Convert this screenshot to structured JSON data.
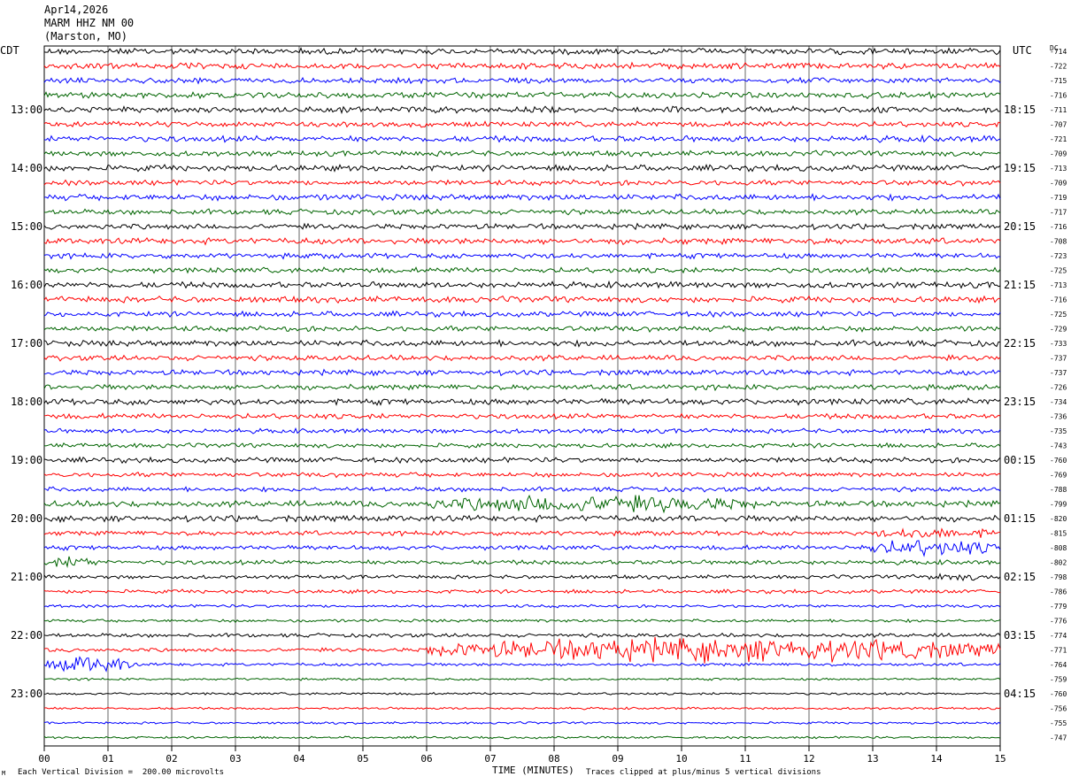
{
  "header": {
    "date": "Apr14,2026",
    "station": "MARM HHZ NM 00",
    "location": "(Marston, MO)"
  },
  "left_tz": "CDT",
  "right_tz": "UTC",
  "dc_label": "DC",
  "footer": {
    "scale_note": "Each Vertical Division =  200.00 microvolts",
    "clip_note": "Traces clipped at plus/minus 5 vertical divisions",
    "corner_mark": "M"
  },
  "chart_data": {
    "type": "line",
    "title": "Apr14,2026",
    "xlabel": "TIME (MINUTES)",
    "ylabel": "",
    "xlim": [
      0,
      15
    ],
    "x_ticks": [
      "00",
      "01",
      "02",
      "03",
      "04",
      "05",
      "06",
      "07",
      "08",
      "09",
      "10",
      "11",
      "12",
      "13",
      "14",
      "15"
    ],
    "trace_colors": [
      "#000000",
      "#ff0000",
      "#0000ff",
      "#006400"
    ],
    "left_time_labels": [
      {
        "trace": 4,
        "label": "13:00"
      },
      {
        "trace": 8,
        "label": "14:00"
      },
      {
        "trace": 12,
        "label": "15:00"
      },
      {
        "trace": 16,
        "label": "16:00"
      },
      {
        "trace": 20,
        "label": "17:00"
      },
      {
        "trace": 24,
        "label": "18:00"
      },
      {
        "trace": 28,
        "label": "19:00"
      },
      {
        "trace": 32,
        "label": "20:00"
      },
      {
        "trace": 36,
        "label": "21:00"
      },
      {
        "trace": 40,
        "label": "22:00"
      },
      {
        "trace": 44,
        "label": "23:00"
      }
    ],
    "right_time_labels": [
      {
        "trace": 4,
        "label": "18:15"
      },
      {
        "trace": 8,
        "label": "19:15"
      },
      {
        "trace": 12,
        "label": "20:15"
      },
      {
        "trace": 16,
        "label": "21:15"
      },
      {
        "trace": 20,
        "label": "22:15"
      },
      {
        "trace": 24,
        "label": "23:15"
      },
      {
        "trace": 28,
        "label": "00:15"
      },
      {
        "trace": 32,
        "label": "01:15"
      },
      {
        "trace": 36,
        "label": "02:15"
      },
      {
        "trace": 40,
        "label": "03:15"
      },
      {
        "trace": 44,
        "label": "04:15"
      }
    ],
    "dc_offsets": [
      -714,
      -722,
      -715,
      -716,
      -711,
      -707,
      -721,
      -709,
      -713,
      -709,
      -719,
      -717,
      -716,
      -708,
      -723,
      -725,
      -713,
      -716,
      -725,
      -729,
      -733,
      -737,
      -737,
      -726,
      -734,
      -736,
      -735,
      -743,
      -760,
      -769,
      -788,
      -799,
      -820,
      -815,
      -808,
      -802,
      -798,
      -786,
      -779,
      -776,
      -774,
      -771,
      -764,
      -759,
      -760,
      -756,
      -755,
      -747
    ],
    "amplitudes": [
      4,
      4,
      3.5,
      4,
      4,
      3.5,
      4,
      3.5,
      4,
      3.5,
      4,
      3.5,
      3.5,
      4,
      3.5,
      3.5,
      4,
      4,
      3.5,
      3.5,
      4,
      3.5,
      3.5,
      3.5,
      4,
      3.5,
      3,
      3,
      3.5,
      3,
      3,
      4,
      4,
      3,
      3,
      3,
      2.5,
      2.5,
      2,
      2,
      2.5,
      2.5,
      2,
      1.5,
      1.5,
      1.5,
      1.5,
      1.5
    ],
    "events": [
      {
        "trace": 31,
        "x_start": 6.0,
        "x_end": 11.2,
        "peak_amplitude": 12
      },
      {
        "trace": 33,
        "x_start": 13.0,
        "x_end": 15.0,
        "peak_amplitude": 8
      },
      {
        "trace": 34,
        "x_start": 12.8,
        "x_end": 15.0,
        "peak_amplitude": 11
      },
      {
        "trace": 35,
        "x_start": 0.0,
        "x_end": 0.9,
        "peak_amplitude": 8
      },
      {
        "trace": 36,
        "x_start": 13.5,
        "x_end": 15.0,
        "peak_amplitude": 5
      },
      {
        "trace": 41,
        "x_start": 6.0,
        "x_end": 15.0,
        "peak_amplitude": 16
      },
      {
        "trace": 42,
        "x_start": 0.0,
        "x_end": 1.4,
        "peak_amplitude": 12
      }
    ]
  }
}
